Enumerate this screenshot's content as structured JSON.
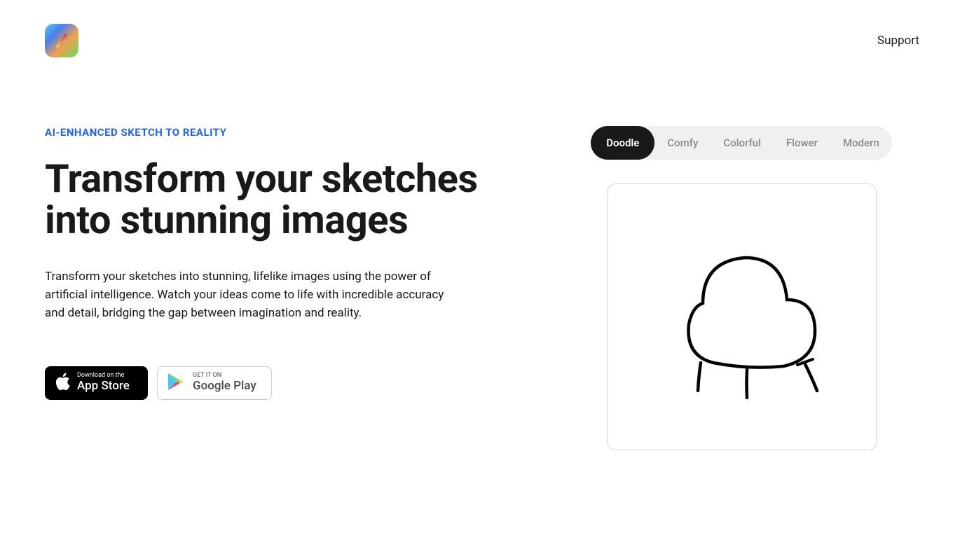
{
  "header": {
    "support_label": "Support"
  },
  "hero": {
    "eyebrow": "AI-ENHANCED SKETCH TO REALITY",
    "headline": "Transform your sketches into stunning images",
    "description": "Transform your sketches into stunning, lifelike images using the power of artificial intelligence. Watch your ideas come to life with incredible accuracy and detail, bridging the gap between imagination and reality."
  },
  "store_buttons": {
    "app_store": {
      "small_text": "Download on the",
      "large_text": "App Store"
    },
    "google_play": {
      "small_text": "GET IT ON",
      "large_text": "Google Play"
    }
  },
  "tabs": {
    "items": [
      {
        "label": "Doodle",
        "active": true
      },
      {
        "label": "Comfy",
        "active": false
      },
      {
        "label": "Colorful",
        "active": false
      },
      {
        "label": "Flower",
        "active": false
      },
      {
        "label": "Modern",
        "active": false
      }
    ]
  }
}
